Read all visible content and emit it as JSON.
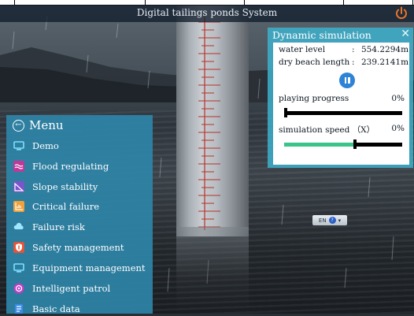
{
  "title": "Digital tailings ponds System",
  "menu": {
    "header": "Menu",
    "items": [
      {
        "label": "Demo",
        "icon": "monitor-icon",
        "color": "#3ab6e8"
      },
      {
        "label": "Flood regulating",
        "icon": "wave-icon",
        "color": "#c0399a"
      },
      {
        "label": "Slope stability",
        "icon": "slope-icon",
        "color": "#7b55c9"
      },
      {
        "label": "Critical failure",
        "icon": "chart-icon",
        "color": "#f0a13a"
      },
      {
        "label": "Failure risk",
        "icon": "cloud-icon",
        "color": "#3ab6e8"
      },
      {
        "label": "Safety management",
        "icon": "shield-icon",
        "color": "#e2553a"
      },
      {
        "label": "Equipment management",
        "icon": "device-icon",
        "color": "#3ab6e8"
      },
      {
        "label": "Intelligent patrol",
        "icon": "patrol-icon",
        "color": "#c13ec9"
      },
      {
        "label": "Basic data",
        "icon": "document-icon",
        "color": "#3a8be8"
      }
    ]
  },
  "simulation": {
    "title": "Dynamic simulation",
    "water_level_label": "water level",
    "water_level_sep": ":",
    "water_level_value": "554.2294m",
    "dry_beach_label": "dry beach length",
    "dry_beach_sep": ":",
    "dry_beach_value": "239.2141m",
    "progress_label": "playing progress",
    "progress_value": "0%",
    "progress_fraction": 0.0,
    "speed_label": "simulation speed （X）",
    "speed_value": "0%",
    "speed_fraction": 0.6
  },
  "lang": {
    "code": "EN",
    "help": "?"
  },
  "colors": {
    "menu_bg": "#2e84a8",
    "panel_bg": "#3eb0cd",
    "speed_fill": "#3ac48a",
    "play_button": "#2d83d6",
    "power": "#e8742a"
  }
}
